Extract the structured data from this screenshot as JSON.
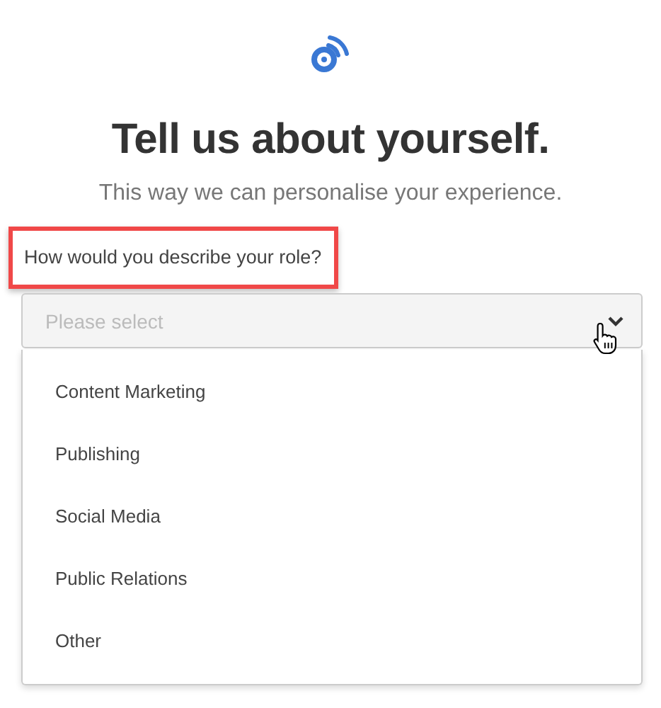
{
  "header": {
    "title": "Tell us about yourself.",
    "subtitle": "This way we can personalise your experience."
  },
  "question": {
    "label": "How would you describe your role?",
    "highlighted": true
  },
  "select": {
    "placeholder": "Please select",
    "expanded": true,
    "options": [
      {
        "label": "Content Marketing",
        "selected": false
      },
      {
        "label": "Publishing",
        "selected": false
      },
      {
        "label": "Social Media",
        "selected": false
      },
      {
        "label": "Public Relations",
        "selected": false
      },
      {
        "label": "Other",
        "selected": false
      }
    ]
  }
}
